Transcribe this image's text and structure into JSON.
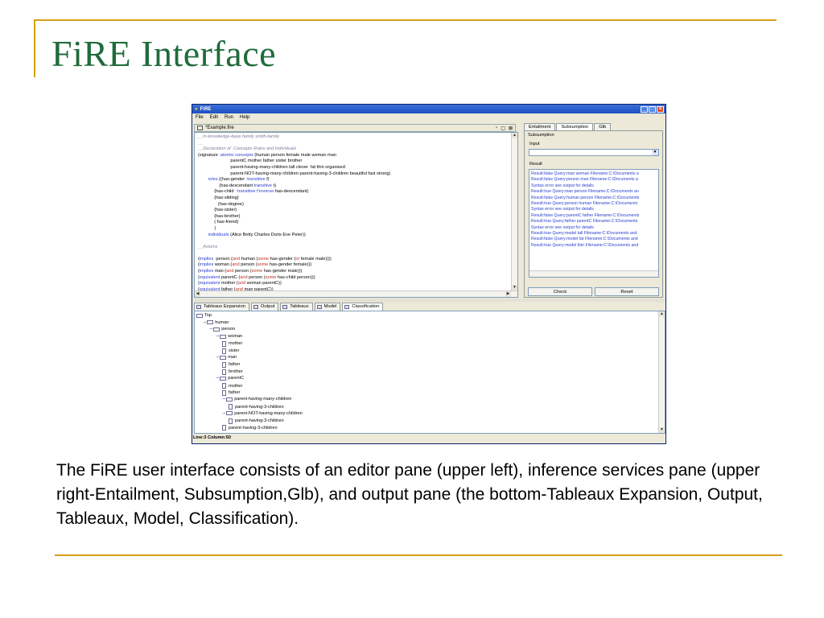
{
  "slide": {
    "title": "FiRE Interface",
    "caption": "The FiRE user interface consists of an editor pane (upper left), inference services pane (upper right-Entailment, Subsumption,Glb), and output pane (the bottom-Tableaux Expansion, Output, Tableaux, Model, Classification)."
  },
  "window": {
    "title": "FiRE",
    "controls": [
      "_",
      "□",
      "×"
    ],
    "menu": [
      "File",
      "Edit",
      "Run",
      "Help"
    ]
  },
  "editor": {
    "tab_title": "*Example.fire",
    "controls": [
      "▫",
      "▢",
      "⊠"
    ],
    "lines": [
      {
        "parts": [
          {
            "t": "__In-knowledge-base family smith-family",
            "c": "cm"
          }
        ]
      },
      {
        "parts": [
          {
            "t": "__",
            "c": "cm"
          }
        ]
      },
      {
        "parts": [
          {
            "t": "__Declaration of  Concepts Rules and Individuals",
            "c": "cm"
          }
        ]
      },
      {
        "parts": [
          {
            "t": "(signature ",
            "c": ""
          },
          {
            "t": ":atomic-concepts",
            "c": "kw"
          },
          {
            "t": " (human person female male woman man",
            "c": ""
          }
        ]
      },
      {
        "parts": [
          {
            "t": "                          parentC mother father sister brother",
            "c": ""
          }
        ]
      },
      {
        "parts": [
          {
            "t": "                          parent-having-many-children tall clever  fat thin organised",
            "c": ""
          }
        ]
      },
      {
        "parts": [
          {
            "t": "                          parent-NOT-having-many-children parent-having-3-children beautiful fast strong)",
            "c": ""
          }
        ]
      },
      {
        "parts": [
          {
            "t": "        ",
            "c": ""
          },
          {
            "t": "roles",
            "c": "kw"
          },
          {
            "t": " ((has-gender ",
            "c": ""
          },
          {
            "t": ":transitive",
            "c": "kw"
          },
          {
            "t": " f)",
            "c": ""
          }
        ]
      },
      {
        "parts": [
          {
            "t": "                 (has-descendant ",
            "c": ""
          },
          {
            "t": "transitive",
            "c": "kw"
          },
          {
            "t": " t)",
            "c": ""
          }
        ]
      },
      {
        "parts": [
          {
            "t": "             (has-child  ",
            "c": ""
          },
          {
            "t": ":transitive f:inverse",
            "c": "kw"
          },
          {
            "t": " has-descendant)",
            "c": ""
          }
        ]
      },
      {
        "parts": [
          {
            "t": "             (has-sibling)",
            "c": ""
          }
        ]
      },
      {
        "parts": [
          {
            "t": "                (has-degree)",
            "c": ""
          }
        ]
      },
      {
        "parts": [
          {
            "t": "             (has-sister)",
            "c": ""
          }
        ]
      },
      {
        "parts": [
          {
            "t": "             (has-brother)",
            "c": ""
          }
        ]
      },
      {
        "parts": [
          {
            "t": "             ( has-friend)",
            "c": ""
          }
        ]
      },
      {
        "parts": [
          {
            "t": "             )",
            "c": ""
          }
        ]
      },
      {
        "parts": [
          {
            "t": "        ",
            "c": ""
          },
          {
            "t": "individuals",
            "c": "kw"
          },
          {
            "t": " (Alice Betty Charles Doris Eve Peter))",
            "c": ""
          }
        ]
      },
      {
        "parts": [
          {
            "t": "",
            "c": ""
          }
        ]
      },
      {
        "parts": [
          {
            "t": "__Axioms",
            "c": "cm"
          }
        ]
      },
      {
        "parts": [
          {
            "t": "",
            "c": ""
          }
        ]
      },
      {
        "parts": [
          {
            "t": "(",
            "c": ""
          },
          {
            "t": "implies",
            "c": "kw"
          },
          {
            "t": "  person (",
            "c": ""
          },
          {
            "t": "and",
            "c": "rd"
          },
          {
            "t": " human (",
            "c": ""
          },
          {
            "t": "some",
            "c": "rd"
          },
          {
            "t": " has-gender (",
            "c": ""
          },
          {
            "t": "or",
            "c": "rd"
          },
          {
            "t": " female male))))",
            "c": ""
          }
        ]
      },
      {
        "parts": [
          {
            "t": "(",
            "c": ""
          },
          {
            "t": "implies",
            "c": "kw"
          },
          {
            "t": " woman (",
            "c": ""
          },
          {
            "t": "and",
            "c": "rd"
          },
          {
            "t": " person (",
            "c": ""
          },
          {
            "t": "some",
            "c": "rd"
          },
          {
            "t": " has-gender female)))",
            "c": ""
          }
        ]
      },
      {
        "parts": [
          {
            "t": "(",
            "c": ""
          },
          {
            "t": "implies",
            "c": "kw"
          },
          {
            "t": " man (",
            "c": ""
          },
          {
            "t": "and",
            "c": "rd"
          },
          {
            "t": " person (",
            "c": ""
          },
          {
            "t": "some",
            "c": "rd"
          },
          {
            "t": " has-gender male)))",
            "c": ""
          }
        ]
      },
      {
        "parts": [
          {
            "t": "(",
            "c": ""
          },
          {
            "t": "equivalent",
            "c": "kw"
          },
          {
            "t": " parentC (",
            "c": ""
          },
          {
            "t": "and",
            "c": "rd"
          },
          {
            "t": " person (",
            "c": ""
          },
          {
            "t": "some",
            "c": "rd"
          },
          {
            "t": " has-child person)))",
            "c": ""
          }
        ]
      },
      {
        "parts": [
          {
            "t": "(",
            "c": ""
          },
          {
            "t": "equivalent",
            "c": "kw"
          },
          {
            "t": " mother (",
            "c": ""
          },
          {
            "t": "and",
            "c": "rd"
          },
          {
            "t": " woman parentC))",
            "c": ""
          }
        ]
      },
      {
        "parts": [
          {
            "t": "(",
            "c": ""
          },
          {
            "t": "equivalent",
            "c": "kw"
          },
          {
            "t": " father (",
            "c": ""
          },
          {
            "t": "and",
            "c": "rd"
          },
          {
            "t": " man parentC))",
            "c": ""
          }
        ]
      }
    ]
  },
  "services": {
    "tabs": [
      "Entailment",
      "Subsumption",
      "Glb"
    ],
    "active_tab": "Subsumption",
    "group_label": "Subsumption",
    "input_label": "Input",
    "input_value": "",
    "result_label": "Result",
    "results": [
      "Result:false Query:man woman Filename:C:\\Documents a",
      "Result:false Query:person man Filename:C:\\Documents a",
      "Syntax error see output for details",
      "Result:true  Query:man person Filename:C:\\Documents an",
      "Result:false Query:human person Filename:C:\\Documents",
      "Result:true  Query:person human Filename:C:\\Documents",
      "Syntax error see output for details",
      "Result:false Query:parentC father Filename:C:\\Documents",
      "Result:true  Query:father parentC Filename:C:\\Documents",
      "Syntax error see output for details",
      "Result:true  Query:model tall Filename:C:\\Documents and",
      "Result:false Query:model fat Filename:C:\\Documents and",
      "Result:true  Query:model thin Filename:C:\\Documents and"
    ],
    "check_label": "Check",
    "reset_label": "Reset"
  },
  "output": {
    "tabs": [
      "Tableaux Expansion",
      "Output",
      "Tableaux",
      "Model",
      "Classification"
    ],
    "active_tab": "Classification",
    "tree": [
      {
        "label": "Top",
        "depth": 0,
        "type": "folder",
        "toggle": false
      },
      {
        "label": "human",
        "depth": 1,
        "type": "folder",
        "toggle": true
      },
      {
        "label": "person",
        "depth": 2,
        "type": "folder",
        "toggle": true
      },
      {
        "label": "woman",
        "depth": 3,
        "type": "folder",
        "toggle": true
      },
      {
        "label": "mother",
        "depth": 4,
        "type": "leaf",
        "toggle": false
      },
      {
        "label": "sister",
        "depth": 4,
        "type": "leaf",
        "toggle": false
      },
      {
        "label": "man",
        "depth": 3,
        "type": "folder",
        "toggle": true
      },
      {
        "label": "father",
        "depth": 4,
        "type": "leaf",
        "toggle": false
      },
      {
        "label": "brother",
        "depth": 4,
        "type": "leaf",
        "toggle": false
      },
      {
        "label": "parentC",
        "depth": 3,
        "type": "folder",
        "toggle": true
      },
      {
        "label": "mother",
        "depth": 4,
        "type": "leaf",
        "toggle": false
      },
      {
        "label": "father",
        "depth": 4,
        "type": "leaf",
        "toggle": false
      },
      {
        "label": "parent-having-many-children",
        "depth": 4,
        "type": "folder",
        "toggle": true
      },
      {
        "label": "parent-having-3-children",
        "depth": 5,
        "type": "leaf",
        "toggle": false
      },
      {
        "label": "parent-NOT-having-many-children",
        "depth": 4,
        "type": "folder",
        "toggle": true
      },
      {
        "label": "parent-having-3-children",
        "depth": 5,
        "type": "leaf",
        "toggle": false
      },
      {
        "label": "parent-having-3-children",
        "depth": 4,
        "type": "leaf",
        "toggle": false
      }
    ]
  },
  "status": "Line:3 Column:50"
}
